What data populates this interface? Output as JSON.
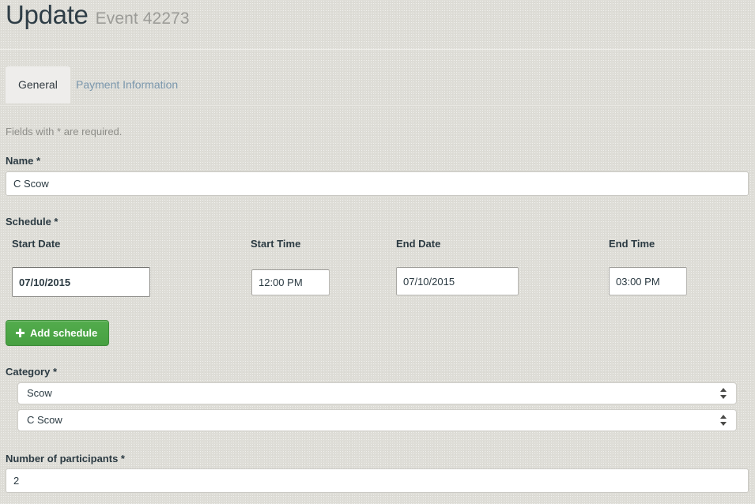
{
  "header": {
    "title": "Update",
    "subtitle": "Event 42273"
  },
  "tabs": [
    {
      "label": "General",
      "active": true
    },
    {
      "label": "Payment Information",
      "active": false
    }
  ],
  "form": {
    "required_note": "Fields with * are required.",
    "name": {
      "label": "Name *",
      "value": "C Scow"
    },
    "schedule": {
      "label": "Schedule *",
      "columns": {
        "start_date": "Start Date",
        "start_time": "Start Time",
        "end_date": "End Date",
        "end_time": "End Time"
      },
      "rows": [
        {
          "start_date": "07/10/2015",
          "start_time": "12:00 PM",
          "end_date": "07/10/2015",
          "end_time": "03:00 PM"
        }
      ],
      "add_button_label": "Add schedule"
    },
    "category": {
      "label": "Category *",
      "primary_value": "Scow",
      "secondary_value": "C Scow"
    },
    "participants": {
      "label": "Number of participants *",
      "value": "2"
    }
  },
  "colors": {
    "background": "#deddd7",
    "accent_green": "#47a041",
    "tab_link": "#7a97ad",
    "text": "#2b3a42",
    "muted_text": "#8d8d88"
  },
  "icons": {
    "plus": "plus-icon",
    "stepper": "updown-stepper-icon"
  }
}
